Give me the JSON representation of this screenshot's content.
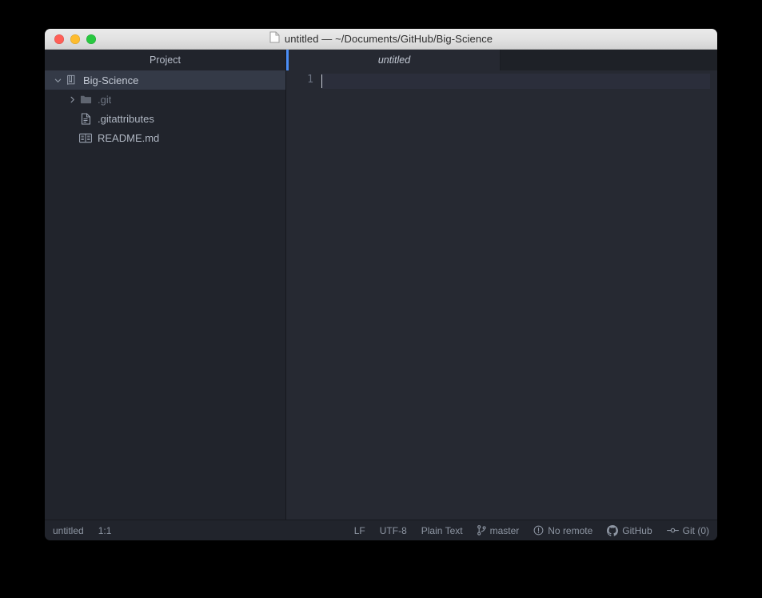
{
  "window": {
    "title": "untitled — ~/Documents/GitHub/Big-Science",
    "title_icon": "document-icon",
    "traffic_lights": [
      {
        "name": "close-button",
        "color": "#ff5f57"
      },
      {
        "name": "minimize-button",
        "color": "#febc2e"
      },
      {
        "name": "maximize-button",
        "color": "#28c840"
      }
    ]
  },
  "sidebar": {
    "header": "Project",
    "tree": [
      {
        "label": "Big-Science",
        "icon": "book-repository-icon",
        "indent": 0,
        "twisty": "chevron-down",
        "selected": true,
        "dim": false
      },
      {
        "label": ".git",
        "icon": "folder-icon",
        "indent": 1,
        "twisty": "chevron-right",
        "selected": false,
        "dim": true
      },
      {
        "label": ".gitattributes",
        "icon": "file-text-icon",
        "indent": 1,
        "twisty": "",
        "selected": false,
        "dim": false
      },
      {
        "label": "README.md",
        "icon": "markdown-book-icon",
        "indent": 1,
        "twisty": "",
        "selected": false,
        "dim": false
      }
    ]
  },
  "tabs": [
    {
      "label": "untitled",
      "active": true,
      "modified": true
    }
  ],
  "editor": {
    "line_numbers": [
      "1"
    ],
    "lines": [
      ""
    ],
    "accent_color": "#4b8ef7"
  },
  "statusbar": {
    "file_name": "untitled",
    "cursor_position": "1:1",
    "line_ending": "LF",
    "encoding": "UTF-8",
    "grammar": "Plain Text",
    "branch": "master",
    "branch_icon": "git-branch-icon",
    "remote": "No remote",
    "remote_icon": "alert-circle-icon",
    "github": "GitHub",
    "github_icon": "github-icon",
    "git_changes": "Git (0)",
    "git_icon": "git-commit-icon"
  }
}
